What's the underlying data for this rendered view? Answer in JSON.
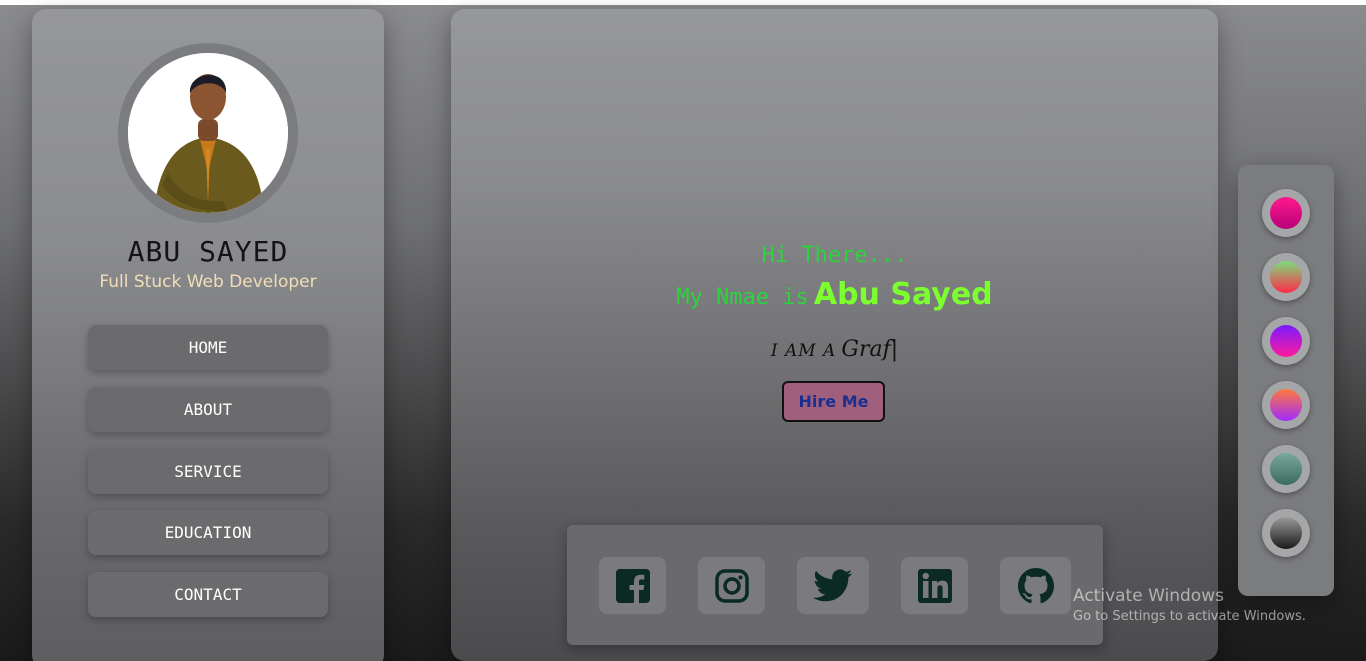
{
  "profile": {
    "name": "ABU SAYED",
    "role": "Full Stuck Web Developer"
  },
  "nav": {
    "items": [
      {
        "label": "HOME"
      },
      {
        "label": "ABOUT"
      },
      {
        "label": "SERVICE"
      },
      {
        "label": "EDUCATION"
      },
      {
        "label": "CONTACT"
      }
    ]
  },
  "hero": {
    "greeting": "Hi There...",
    "intro_prefix": "My Nmae is",
    "intro_name": "Abu Sayed",
    "typed_prefix": "I AM A",
    "typed_word": "Graf|",
    "hire_label": "Hire Me"
  },
  "social": {
    "icons": [
      "facebook-icon",
      "instagram-icon",
      "twitter-icon",
      "linkedin-icon",
      "github-icon"
    ]
  },
  "theme_swatches": [
    {
      "name": "magenta",
      "colors": [
        "#ff1a8c",
        "#b8007a"
      ]
    },
    {
      "name": "green-red",
      "colors": [
        "#7cdc7a",
        "#ff2a4a"
      ]
    },
    {
      "name": "purple-pink",
      "colors": [
        "#7a1aff",
        "#ff1a9c"
      ]
    },
    {
      "name": "orange-purple",
      "colors": [
        "#ff7a3a",
        "#a02aff"
      ]
    },
    {
      "name": "teal-gray",
      "colors": [
        "#7aa89a",
        "#3b6a5f"
      ]
    },
    {
      "name": "gray-black",
      "colors": [
        "#9a9a9a",
        "#1a1a1a"
      ]
    }
  ],
  "watermark": {
    "title": "Activate Windows",
    "subtitle": "Go to Settings to activate Windows."
  },
  "colors": {
    "greeting": "#2bd33d",
    "name_accent": "#7cff2e",
    "hire_bg": "#a0607c",
    "icon_color": "#0a2a22"
  }
}
